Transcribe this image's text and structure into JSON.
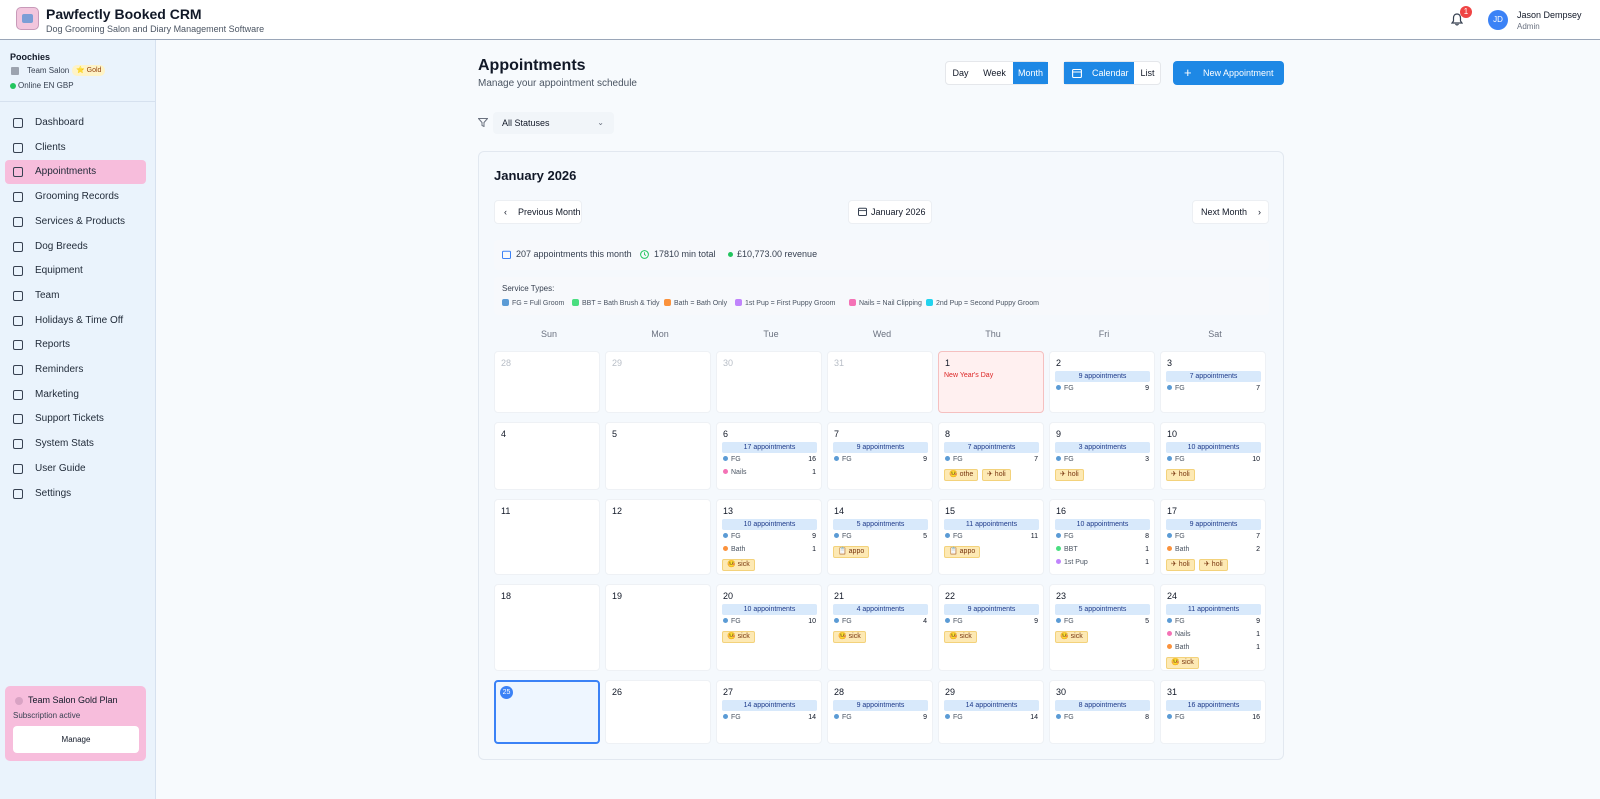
{
  "header": {
    "app_title": "Pawfectly Booked CRM",
    "app_subtitle": "Dog Grooming Salon and Diary Management Software",
    "notification_count": "1",
    "user_initials": "JD",
    "user_name": "Jason Dempsey",
    "user_role": "Admin"
  },
  "sidebar": {
    "org_name": "Poochies",
    "plan_name": "Team Salon",
    "plan_badge": "⭐ Gold",
    "status": "Online  EN  GBP",
    "items": [
      {
        "label": "Dashboard",
        "icon": "home-icon"
      },
      {
        "label": "Clients",
        "icon": "users-icon"
      },
      {
        "label": "Appointments",
        "icon": "calendar-icon",
        "active": true
      },
      {
        "label": "Grooming Records",
        "icon": "clipboard-icon"
      },
      {
        "label": "Services & Products",
        "icon": "scissors-icon"
      },
      {
        "label": "Dog Breeds",
        "icon": "paw-icon"
      },
      {
        "label": "Equipment",
        "icon": "truck-icon"
      },
      {
        "label": "Team",
        "icon": "team-icon"
      },
      {
        "label": "Holidays & Time Off",
        "icon": "plane-icon"
      },
      {
        "label": "Reports",
        "icon": "bar-chart-icon"
      },
      {
        "label": "Reminders",
        "icon": "message-icon"
      },
      {
        "label": "Marketing",
        "icon": "mail-icon"
      },
      {
        "label": "Support Tickets",
        "icon": "headset-icon"
      },
      {
        "label": "System Stats",
        "icon": "activity-icon"
      },
      {
        "label": "User Guide",
        "icon": "help-icon"
      },
      {
        "label": "Settings",
        "icon": "gear-icon"
      }
    ],
    "plan_card": {
      "title": "Team Salon Gold Plan",
      "status": "Subscription active",
      "button": "Manage"
    }
  },
  "main": {
    "title": "Appointments",
    "subtitle": "Manage your appointment schedule",
    "view_modes": [
      "Day",
      "Week",
      "Month"
    ],
    "active_view": "Month",
    "layout_modes": [
      "Calendar",
      "List"
    ],
    "active_layout": "Calendar",
    "new_button": "New Appointment",
    "status_filter": "All Statuses"
  },
  "calendar": {
    "month_title": "January 2026",
    "prev_label": "Previous Month",
    "current_label": "January 2026",
    "next_label": "Next Month",
    "stats": {
      "appointments": "207 appointments this month",
      "minutes": "17810 min total",
      "revenue": "£10,773.00 revenue"
    },
    "legend_title": "Service Types:",
    "legend": [
      {
        "label": "FG = Full Groom",
        "color": "#5b9bd5"
      },
      {
        "label": "BBT = Bath Brush & Tidy",
        "color": "#4ade80"
      },
      {
        "label": "Bath = Bath Only",
        "color": "#fb923c"
      },
      {
        "label": "1st Pup = First Puppy Groom",
        "color": "#c084fc"
      },
      {
        "label": "Nails = Nail Clipping",
        "color": "#f472b6"
      },
      {
        "label": "2nd Pup = Second Puppy Groom",
        "color": "#22d3ee"
      }
    ],
    "weekdays": [
      "Sun",
      "Mon",
      "Tue",
      "Wed",
      "Thu",
      "Fri",
      "Sat"
    ],
    "service_colors": {
      "FG": "#5b9bd5",
      "BBT": "#4ade80",
      "Bath": "#fb923c",
      "1st Pup": "#c084fc",
      "Nails": "#f472b6",
      "2nd Pup": "#22d3ee"
    },
    "weeks": [
      [
        {
          "day": "28",
          "dim": true
        },
        {
          "day": "29",
          "dim": true
        },
        {
          "day": "30",
          "dim": true
        },
        {
          "day": "31",
          "dim": true
        },
        {
          "day": "1",
          "holiday": "New Year's Day"
        },
        {
          "day": "2",
          "appts": "9 appointments",
          "services": [
            [
              "FG",
              "9"
            ]
          ]
        },
        {
          "day": "3",
          "appts": "7 appointments",
          "services": [
            [
              "FG",
              "7"
            ]
          ]
        }
      ],
      [
        {
          "day": "4"
        },
        {
          "day": "5"
        },
        {
          "day": "6",
          "appts": "17 appointments",
          "services": [
            [
              "FG",
              "16"
            ],
            [
              "Nails",
              "1"
            ]
          ]
        },
        {
          "day": "7",
          "appts": "9 appointments",
          "services": [
            [
              "FG",
              "9"
            ]
          ]
        },
        {
          "day": "8",
          "appts": "7 appointments",
          "services": [
            [
              "FG",
              "7"
            ]
          ],
          "tags": [
            "🤒 othe",
            "✈ holi"
          ]
        },
        {
          "day": "9",
          "appts": "3 appointments",
          "services": [
            [
              "FG",
              "3"
            ]
          ],
          "tags": [
            "✈ holi"
          ]
        },
        {
          "day": "10",
          "appts": "10 appointments",
          "services": [
            [
              "FG",
              "10"
            ]
          ],
          "tags": [
            "✈ holi"
          ]
        }
      ],
      [
        {
          "day": "11"
        },
        {
          "day": "12"
        },
        {
          "day": "13",
          "appts": "10 appointments",
          "services": [
            [
              "FG",
              "9"
            ],
            [
              "Bath",
              "1"
            ]
          ],
          "tags": [
            "🤒 sick"
          ]
        },
        {
          "day": "14",
          "appts": "5 appointments",
          "services": [
            [
              "FG",
              "5"
            ]
          ],
          "tags": [
            "📋 appo"
          ]
        },
        {
          "day": "15",
          "appts": "11 appointments",
          "services": [
            [
              "FG",
              "11"
            ]
          ],
          "tags": [
            "📋 appo"
          ]
        },
        {
          "day": "16",
          "appts": "10 appointments",
          "services": [
            [
              "FG",
              "8"
            ],
            [
              "BBT",
              "1"
            ],
            [
              "1st Pup",
              "1"
            ]
          ]
        },
        {
          "day": "17",
          "appts": "9 appointments",
          "services": [
            [
              "FG",
              "7"
            ],
            [
              "Bath",
              "2"
            ]
          ],
          "tags": [
            "✈ holi",
            "✈ holi"
          ]
        }
      ],
      [
        {
          "day": "18"
        },
        {
          "day": "19"
        },
        {
          "day": "20",
          "appts": "10 appointments",
          "services": [
            [
              "FG",
              "10"
            ]
          ],
          "tags": [
            "🤒 sick"
          ]
        },
        {
          "day": "21",
          "appts": "4 appointments",
          "services": [
            [
              "FG",
              "4"
            ]
          ],
          "tags": [
            "🤒 sick"
          ]
        },
        {
          "day": "22",
          "appts": "9 appointments",
          "services": [
            [
              "FG",
              "9"
            ]
          ],
          "tags": [
            "🤒 sick"
          ]
        },
        {
          "day": "23",
          "appts": "5 appointments",
          "services": [
            [
              "FG",
              "5"
            ]
          ],
          "tags": [
            "🤒 sick"
          ]
        },
        {
          "day": "24",
          "appts": "11 appointments",
          "services": [
            [
              "FG",
              "9"
            ],
            [
              "Nails",
              "1"
            ],
            [
              "Bath",
              "1"
            ]
          ],
          "tags": [
            "🤒 sick"
          ]
        }
      ],
      [
        {
          "day": "25",
          "today": true
        },
        {
          "day": "26"
        },
        {
          "day": "27",
          "appts": "14 appointments",
          "services": [
            [
              "FG",
              "14"
            ]
          ]
        },
        {
          "day": "28",
          "appts": "9 appointments",
          "services": [
            [
              "FG",
              "9"
            ]
          ]
        },
        {
          "day": "29",
          "appts": "14 appointments",
          "services": [
            [
              "FG",
              "14"
            ]
          ]
        },
        {
          "day": "30",
          "appts": "8 appointments",
          "services": [
            [
              "FG",
              "8"
            ]
          ]
        },
        {
          "day": "31",
          "appts": "16 appointments",
          "services": [
            [
              "FG",
              "16"
            ]
          ]
        }
      ]
    ]
  }
}
